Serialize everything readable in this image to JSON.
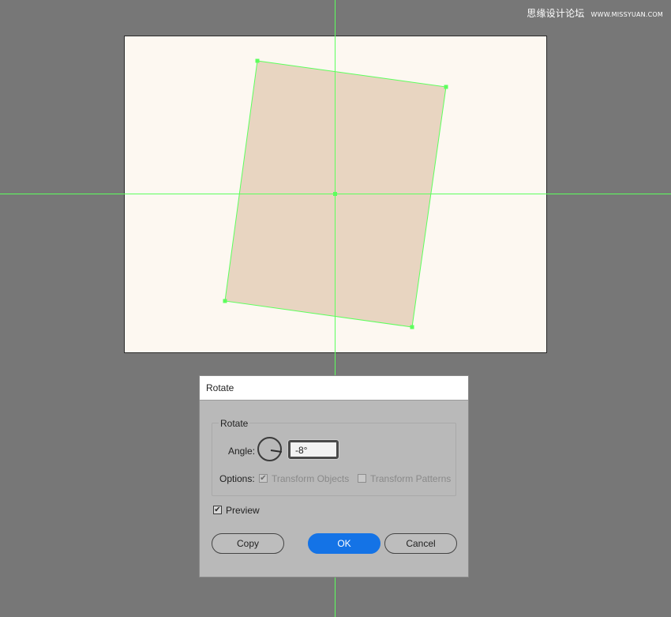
{
  "watermark": {
    "text": "思缘设计论坛",
    "url": "WWW.MISSYUAN.COM"
  },
  "dialog": {
    "title": "Rotate",
    "group_title": "Rotate",
    "angle_label": "Angle:",
    "angle_value": "-8°",
    "options_label": "Options:",
    "transform_objects": "Transform Objects",
    "transform_patterns": "Transform Patterns",
    "preview": "Preview",
    "copy": "Copy",
    "ok": "OK",
    "cancel": "Cancel"
  },
  "state": {
    "transform_objects_checked": true,
    "transform_patterns_checked": false,
    "preview_checked": true,
    "angle_degrees": -8
  },
  "colors": {
    "canvas_bg": "#777777",
    "artboard": "#fdf8f1",
    "shape_fill": "#e8d5c1",
    "selection_guide": "#5dff5d",
    "dialog_bg": "#b9b9b9",
    "primary_button": "#1473e6"
  },
  "icons": {
    "checkmark": "✔"
  }
}
